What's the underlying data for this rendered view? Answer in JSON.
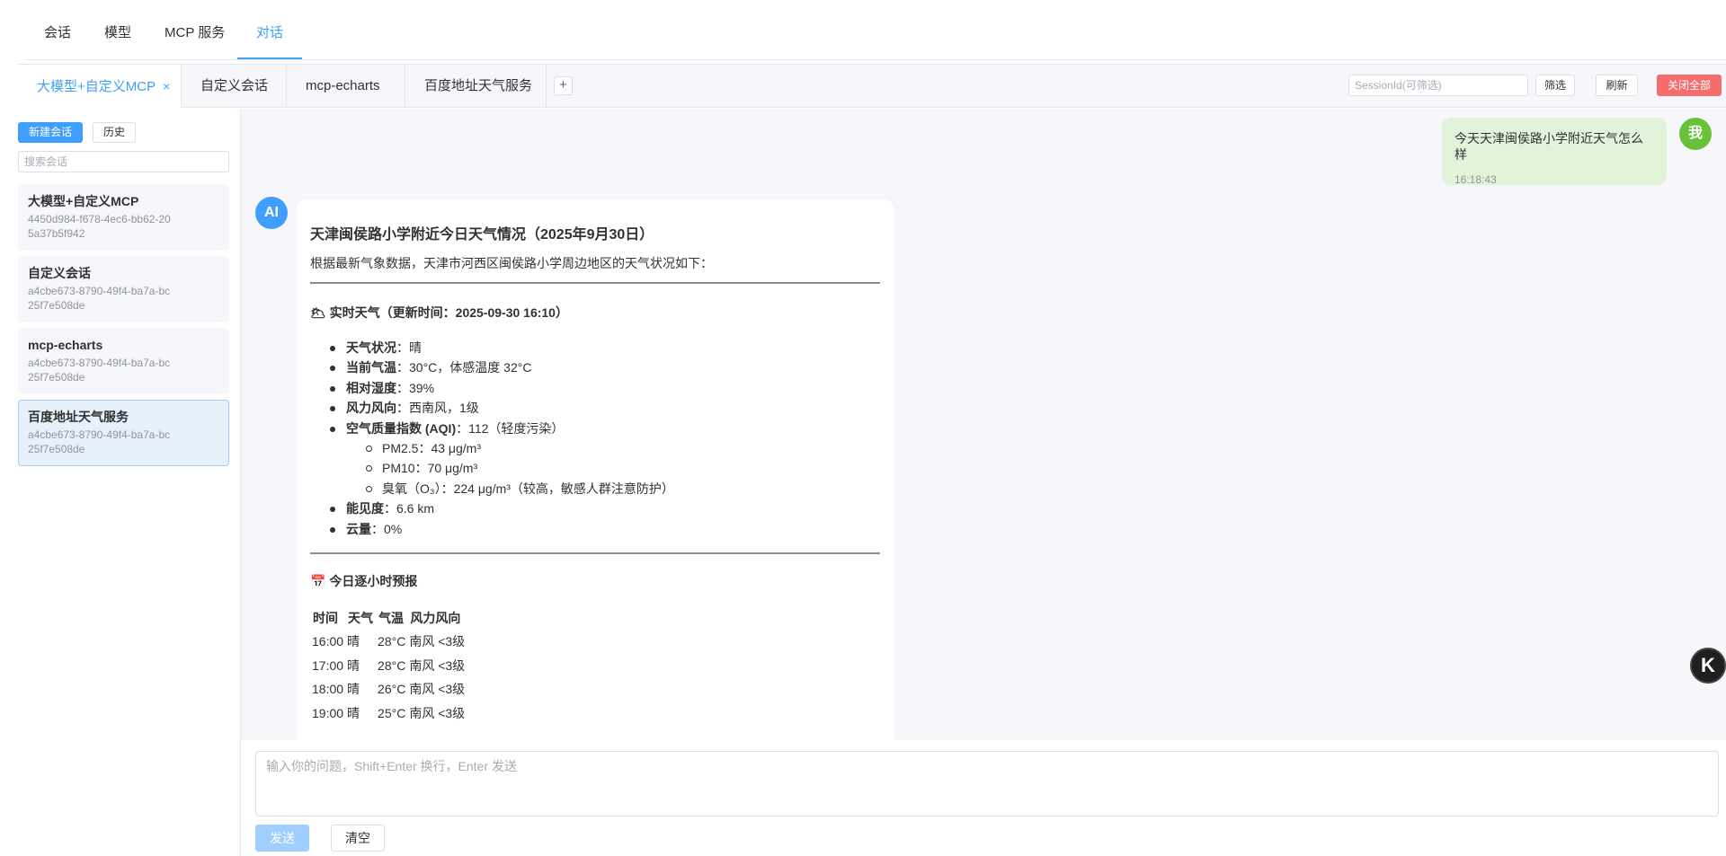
{
  "top_nav": {
    "tabs": [
      "会话",
      "模型",
      "MCP 服务",
      "对话"
    ],
    "active": "对话"
  },
  "session_tabs": {
    "tabs": [
      "大模型+自定义MCP",
      "自定义会话",
      "mcp-echarts",
      "百度地址天气服务"
    ],
    "active": "大模型+自定义MCP",
    "close_symbol": "×",
    "add_symbol": "+",
    "filter_placeholder": "SessionId(可筛选)",
    "filter_button": "筛选",
    "refresh_button": "刷新",
    "close_all_button": "关闭全部"
  },
  "sidebar": {
    "new_button": "新建会话",
    "history_button": "历史",
    "search_placeholder": "搜索会话",
    "conversations": [
      {
        "title": "大模型+自定义MCP",
        "id": "4450d984-f678-4ec6-bb62-205a37b5f942"
      },
      {
        "title": "自定义会话",
        "id": "a4cbe673-8790-49f4-ba7a-bc25f7e508de"
      },
      {
        "title": "mcp-echarts",
        "id": "a4cbe673-8790-49f4-ba7a-bc25f7e508de"
      },
      {
        "title": "百度地址天气服务",
        "id": "a4cbe673-8790-49f4-ba7a-bc25f7e508de"
      }
    ],
    "active_index": 3
  },
  "chat": {
    "user_avatar": "我",
    "ai_avatar": "AI",
    "user_message": "今天天津闽侯路小学附近天气怎么样",
    "user_time": "16:18:43",
    "ai": {
      "title": "天津闽侯路小学附近今日天气情况（2025年9月30日）",
      "intro": "根据最新气象数据，天津市河西区闽侯路小学周边地区的天气状况如下：",
      "realtime_heading": "🌥 实时天气（更新时间：2025-09-30 16:10）",
      "items": [
        {
          "label": "天气状况",
          "value": "：晴"
        },
        {
          "label": "当前气温",
          "value": "：30°C，体感温度 32°C"
        },
        {
          "label": "相对湿度",
          "value": "：39%"
        },
        {
          "label": "风力风向",
          "value": "：西南风，1级"
        },
        {
          "label": "空气质量指数 (AQI)",
          "value": "：112（轻度污染）"
        }
      ],
      "sub_items": [
        "PM2.5：43 μg/m³",
        "PM10：70 μg/m³",
        "臭氧（O₃）：224 μg/m³（较高，敏感人群注意防护）"
      ],
      "items2": [
        {
          "label": "能见度",
          "value": "：6.6 km"
        },
        {
          "label": "云量",
          "value": "：0%"
        }
      ],
      "forecast_heading": "📅 今日逐小时预报",
      "forecast_headers": [
        "时间",
        "天气",
        "气温",
        "风力风向"
      ],
      "forecast_rows": [
        [
          "16:00",
          "晴",
          "28°C",
          "南风 <3级"
        ],
        [
          "17:00",
          "晴",
          "28°C",
          "南风 <3级"
        ],
        [
          "18:00",
          "晴",
          "26°C",
          "南风 <3级"
        ],
        [
          "19:00",
          "晴",
          "25°C",
          "南风 <3级"
        ]
      ]
    }
  },
  "composer": {
    "placeholder": "输入你的问题，Shift+Enter 换行，Enter 发送",
    "send_button": "发送",
    "clear_button": "清空"
  },
  "fab_label": "K",
  "colors": {
    "accent": "#409eff",
    "danger": "#f56c6c",
    "user_bubble": "#e1f3d8",
    "user_avatar": "#67c23a"
  }
}
